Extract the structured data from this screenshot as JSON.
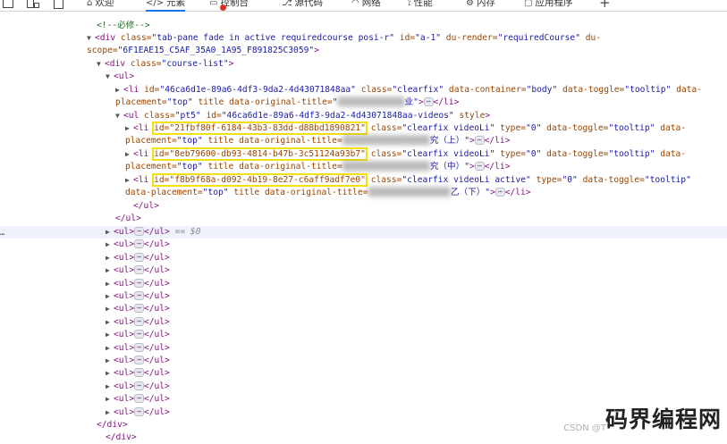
{
  "toolbar": {
    "tabs": [
      {
        "label": "欢迎",
        "icon": "home-icon"
      },
      {
        "label": "元素",
        "icon": "code-icon",
        "active": true
      },
      {
        "label": "控制台",
        "icon": "console-icon"
      },
      {
        "label": "源代码",
        "icon": "sources-icon"
      },
      {
        "label": "网络",
        "icon": "wifi-icon"
      },
      {
        "label": "性能",
        "icon": "performance-icon"
      },
      {
        "label": "内存",
        "icon": "gear-icon"
      },
      {
        "label": "应用程序",
        "icon": "application-icon"
      }
    ],
    "add_tab": "+"
  },
  "dom": {
    "comment": "<!--必修-->",
    "div1": {
      "tag_open": "<div ",
      "class_attr": "class=",
      "class_val": "\"tab-pane fade in active requiredcourse posi-r\"",
      "id_attr": "id=",
      "id_val": "\"a-1\"",
      "render_attr": "du-render=",
      "render_val": "\"requiredCourse\"",
      "scope_attr": "du-scope=",
      "scope_val": "\"6F1EAE15_C5AF_35A0_1A95_F891825C3059\"",
      "tag_close": ">"
    },
    "course_list": {
      "open": "<div ",
      "attr": "class=",
      "val": "\"course-list\"",
      "close": ">"
    },
    "ul_open": "<ul>",
    "li_first": {
      "open": "<li ",
      "id_attr": "id=",
      "id_val": "\"46ca6d1e-89a6-4df3-9da2-4d43071848aa\"",
      "class_attr": "class=",
      "class_val": "\"clearfix\"",
      "container_attr": "data-container=",
      "container_val": "\"body\"",
      "toggle_attr": "data-toggle=",
      "toggle_val": "\"tooltip\"",
      "placement_attr": "data-placement=",
      "placement_val": "\"top\"",
      "title_attr": "title",
      "orig_attr": "data-original-title=",
      "orig_val_start": "\"",
      "orig_val_end": "业\"",
      "close": ">",
      "dots": "⋯",
      "end_tag": "</li>"
    },
    "ul_videos": {
      "open": "<ul ",
      "class_attr": "class=",
      "class_val": "\"pt5\"",
      "id_attr": "id=",
      "id_val": "\"46ca6d1e-89a6-4df3-9da2-4d43071848aa-videos\"",
      "style_attr": "style",
      "close": ">"
    },
    "videos": [
      {
        "open": "<li ",
        "id_text": "id=\"21fbf80f-6184-43b3-83dd-d88bd1890821\"",
        "class_attr": "class=",
        "class_val": "\"clearfix videoLi\"",
        "type_attr": "type=",
        "type_val": "\"0\"",
        "toggle_attr": "data-toggle=",
        "toggle_val": "\"tooltip\"",
        "toggle_attr2": "data-",
        "placement_attr": "placement=",
        "placement_val": "\"top\"",
        "title_attr": "title",
        "orig_attr": "data-original-title=",
        "orig_val_end": "究（上）\"",
        "close": ">",
        "dots": "⋯",
        "end_tag": "</li>"
      },
      {
        "open": "<li ",
        "id_text": "id=\"8eb79600-db93-4814-b47b-3c51124a93b7\"",
        "class_attr": "class=",
        "class_val": "\"clearfix videoLi\"",
        "type_attr": "type=",
        "type_val": "\"0\"",
        "toggle_attr": "data-toggle=",
        "toggle_val": "\"tooltip\"",
        "toggle_attr2": "data-",
        "placement_attr": "placement=",
        "placement_val": "\"top\"",
        "title_attr": "title",
        "orig_attr": "data-original-title=",
        "orig_val_end": "究（中）\"",
        "close": ">",
        "dots": "⋯",
        "end_tag": "</li>"
      },
      {
        "open": "<li ",
        "id_text": "id=\"f8b9f68a-d092-4b19-8e27-c6aff9adf7e0\"",
        "class_attr": "class=",
        "class_val": "\"clearfix videoLi active\"",
        "type_attr": "type=",
        "type_val": "\"0\"",
        "toggle_attr": "data-toggle=",
        "toggle_val": "\"tooltip\"",
        "toggle_attr2": "",
        "placement_attr": "data-placement=",
        "placement_val": "\"top\"",
        "title_attr": "title",
        "orig_attr": "data-original-title=",
        "orig_val_end": "乙（下）\"",
        "close": ">",
        "dots": "⋯",
        "end_tag": "</li>"
      }
    ],
    "ul_close": "</ul>",
    "ul_close2": "</ul>",
    "ul_collapsed": {
      "open": "<ul>",
      "dots": "⋯",
      "close": "</ul>",
      "dollar": "== $0"
    },
    "ul_rows_count_label": "",
    "div_close": "</div>",
    "div_close_partial": "</div>"
  },
  "gutter_dots": "⋯",
  "watermark": {
    "small": "CSDN @T",
    "big": "码界编程网"
  }
}
